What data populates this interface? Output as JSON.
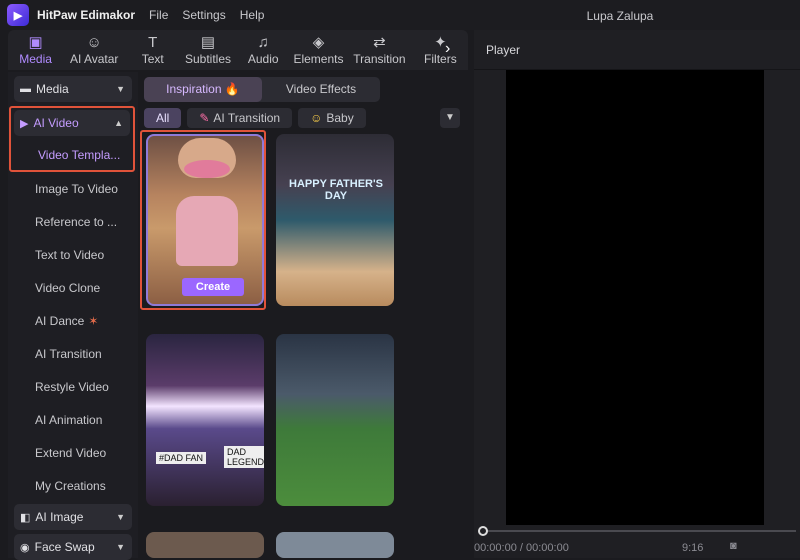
{
  "app": {
    "name": "HitPaw Edimakor",
    "project": "Lupa Zalupa",
    "menu": [
      "File",
      "Settings",
      "Help"
    ]
  },
  "toolbar": {
    "items": [
      {
        "label": "Media",
        "icon": "image-icon"
      },
      {
        "label": "AI Avatar",
        "icon": "avatar-icon"
      },
      {
        "label": "Text",
        "icon": "text-icon"
      },
      {
        "label": "Subtitles",
        "icon": "subtitles-icon"
      },
      {
        "label": "Audio",
        "icon": "music-icon"
      },
      {
        "label": "Elements",
        "icon": "elements-icon"
      },
      {
        "label": "Transition",
        "icon": "transition-icon"
      },
      {
        "label": "Filters",
        "icon": "filters-icon"
      }
    ]
  },
  "sidebar": {
    "media": "Media",
    "ai_video": "AI Video",
    "items": [
      "Video Templa...",
      "Image To Video",
      "Reference to ...",
      "Text to Video",
      "Video Clone",
      "AI Dance",
      "AI Transition",
      "Restyle Video",
      "AI Animation",
      "Extend Video",
      "My Creations"
    ],
    "ai_image": "AI Image",
    "face_swap": "Face Swap"
  },
  "content": {
    "tabs": [
      "Inspiration",
      "Video Effects"
    ],
    "chips": [
      "All",
      "AI Transition",
      "Baby"
    ],
    "card_button": "Create",
    "card2_text": "HAPPY FATHER'S DAY",
    "card3_text1": "#DAD FAN",
    "card3_text2": "DAD LEGEND"
  },
  "player": {
    "title": "Player",
    "time": "00:00:00 / 00:00:00",
    "ratio": "9:16"
  }
}
